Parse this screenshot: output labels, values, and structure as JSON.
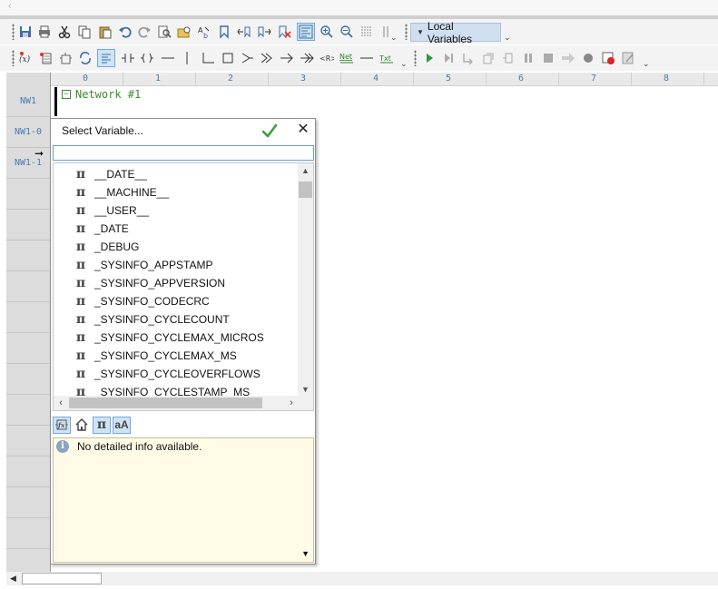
{
  "top_strip": {
    "arrow_glyph": "‹"
  },
  "toolbar2": {
    "more_glyph": "⌄"
  },
  "local_variables": {
    "label": "Local Variables"
  },
  "ruler": {
    "ticks": [
      "0",
      "1",
      "2",
      "3",
      "4",
      "5",
      "6",
      "7",
      "8"
    ]
  },
  "gutter": {
    "rows": [
      "NW1",
      "NW1-0",
      "NW1-1"
    ]
  },
  "network": {
    "label": "Network #1",
    "collapse_glyph": "−"
  },
  "dialog": {
    "title": "Select Variable...",
    "search_value": "",
    "items": [
      "__DATE__",
      "__MACHINE__",
      "__USER__",
      "_DATE",
      "_DEBUG",
      "_SYSINFO_APPSTAMP",
      "_SYSINFO_APPVERSION",
      "_SYSINFO_CODECRC",
      "_SYSINFO_CYCLECOUNT",
      "_SYSINFO_CYCLEMAX_MICROS",
      "_SYSINFO_CYCLEMAX_MS",
      "_SYSINFO_CYCLEOVERFLOWS",
      "_SYSINFO_CYCLESTAMP_MS"
    ],
    "item_glyph": "π",
    "filters": {
      "pi_label": "π",
      "case_label": "aA"
    },
    "info_text": "No detailed info available."
  },
  "colors": {
    "accent": "#4a7ab0",
    "network_green": "#3b8a2f",
    "info_bg": "#fffbe6"
  }
}
